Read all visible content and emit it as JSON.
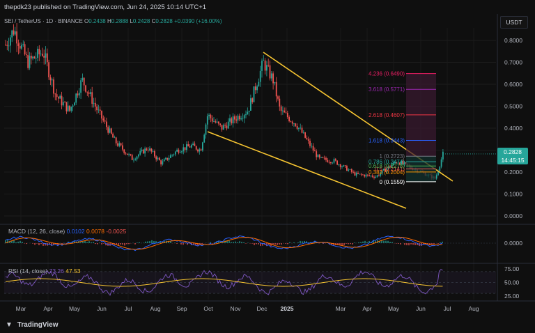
{
  "header": {
    "text": "thepdk23 published on TradingView.com, Jun 24, 2025 10:14 UTC+1"
  },
  "symbol": {
    "name": "SEI / TetherUS · 1D · BINANCE",
    "open_label": "O",
    "open": "0.2438",
    "high_label": "H",
    "high": "0.2888",
    "low_label": "L",
    "low": "0.2428",
    "close_label": "C",
    "close": "0.2828",
    "change": "+0.0390 (+16.00%)"
  },
  "currency": "USDT",
  "last_price": {
    "value": "0.2828",
    "countdown": "14:45:15"
  },
  "footer": {
    "logo_text": "TradingView"
  },
  "indicators": {
    "macd": {
      "label": "MACD (12, 26, close)",
      "macd": "0.0102",
      "signal": "0.0078",
      "hist": "-0.0025"
    },
    "rsi": {
      "label": "RSI (14, close)",
      "value1": "73.26",
      "value2": "47.53"
    }
  },
  "colors": {
    "up": "#26a69a",
    "down": "#ef5350",
    "wedge": "#f7c531",
    "background": "#0f0f0f"
  },
  "chart_data": {
    "type": "candlestick",
    "price_axis": {
      "ticks": [
        "0.0000",
        "0.1000",
        "0.2000",
        "0.3000",
        "0.4000",
        "0.5000",
        "0.6000",
        "0.7000",
        "0.8000"
      ],
      "range": [
        0,
        0.8
      ]
    },
    "x_ticks": [
      "Mar",
      "Apr",
      "May",
      "Jun",
      "Jul",
      "Aug",
      "Sep",
      "Oct",
      "Nov",
      "Dec",
      "2025",
      "Mar",
      "Apr",
      "May",
      "Jun",
      "Jul",
      "Aug"
    ],
    "price_path": [
      [
        "Mar",
        0.78
      ],
      [
        "Mar",
        0.85
      ],
      [
        "Mar",
        0.7
      ],
      [
        "Apr",
        0.75
      ],
      [
        "Apr",
        0.55
      ],
      [
        "May",
        0.48
      ],
      [
        "May",
        0.62
      ],
      [
        "Jun",
        0.48
      ],
      [
        "Jun",
        0.34
      ],
      [
        "Jul",
        0.26
      ],
      [
        "Jul",
        0.31
      ],
      [
        "Aug",
        0.24
      ],
      [
        "Aug",
        0.3
      ],
      [
        "Sep",
        0.32
      ],
      [
        "Sep",
        0.3
      ],
      [
        "Oct",
        0.46
      ],
      [
        "Oct",
        0.4
      ],
      [
        "Nov",
        0.45
      ],
      [
        "Nov",
        0.48
      ],
      [
        "Dec",
        0.7
      ],
      [
        "Dec",
        0.62
      ],
      [
        "2025",
        0.48
      ],
      [
        "2025",
        0.42
      ],
      [
        "Mar",
        0.26
      ],
      [
        "Mar",
        0.25
      ],
      [
        "Apr",
        0.19
      ],
      [
        "Apr",
        0.18
      ],
      [
        "May",
        0.25
      ],
      [
        "May",
        0.22
      ],
      [
        "Jun",
        0.2
      ],
      [
        "Jun",
        0.17
      ],
      [
        "Jul",
        0.2828
      ]
    ],
    "fib_levels": [
      {
        "ratio": "0",
        "label": "0 (0.1559)",
        "price": 0.1559,
        "color": "#ffffff"
      },
      {
        "ratio": "0.382",
        "label": "0.382 (0.2004)",
        "price": 0.2004,
        "color": "#ff9800"
      },
      {
        "ratio": "0.5",
        "label": "0.5 (0.2141)",
        "price": 0.2141,
        "color": "#ef5350"
      },
      {
        "ratio": "0.618",
        "label": "0.618 (0.2278)",
        "price": 0.2278,
        "color": "#4caf50"
      },
      {
        "ratio": "0.786",
        "label": "0.786 (0.2474)",
        "price": 0.2474,
        "color": "#26a69a"
      },
      {
        "ratio": "1",
        "label": "1 (0.2723)",
        "price": 0.2723,
        "color": "#787b86"
      },
      {
        "ratio": "1.618",
        "label": "1.618 (0.3443)",
        "price": 0.3443,
        "color": "#2962ff"
      },
      {
        "ratio": "2.618",
        "label": "2.618 (0.4607)",
        "price": 0.4607,
        "color": "#f23645"
      },
      {
        "ratio": "3.618",
        "label": "3.618 (0.5771)",
        "price": 0.5771,
        "color": "#9c27b0"
      },
      {
        "ratio": "4.236",
        "label": "4.236 (0.6490)",
        "price": 0.649,
        "color": "#e91e63"
      }
    ],
    "wedge": {
      "upper": [
        [
          "Dec",
          0.74
        ],
        [
          "Jul",
          0.165
        ]
      ],
      "lower": [
        [
          "Oct",
          0.38
        ],
        [
          "Jun",
          0.04
        ]
      ]
    },
    "macd_axis": {
      "ticks": [
        "0.0000"
      ]
    },
    "rsi_axis": {
      "ticks": [
        "75.00",
        "50.00",
        "25.00"
      ]
    }
  }
}
